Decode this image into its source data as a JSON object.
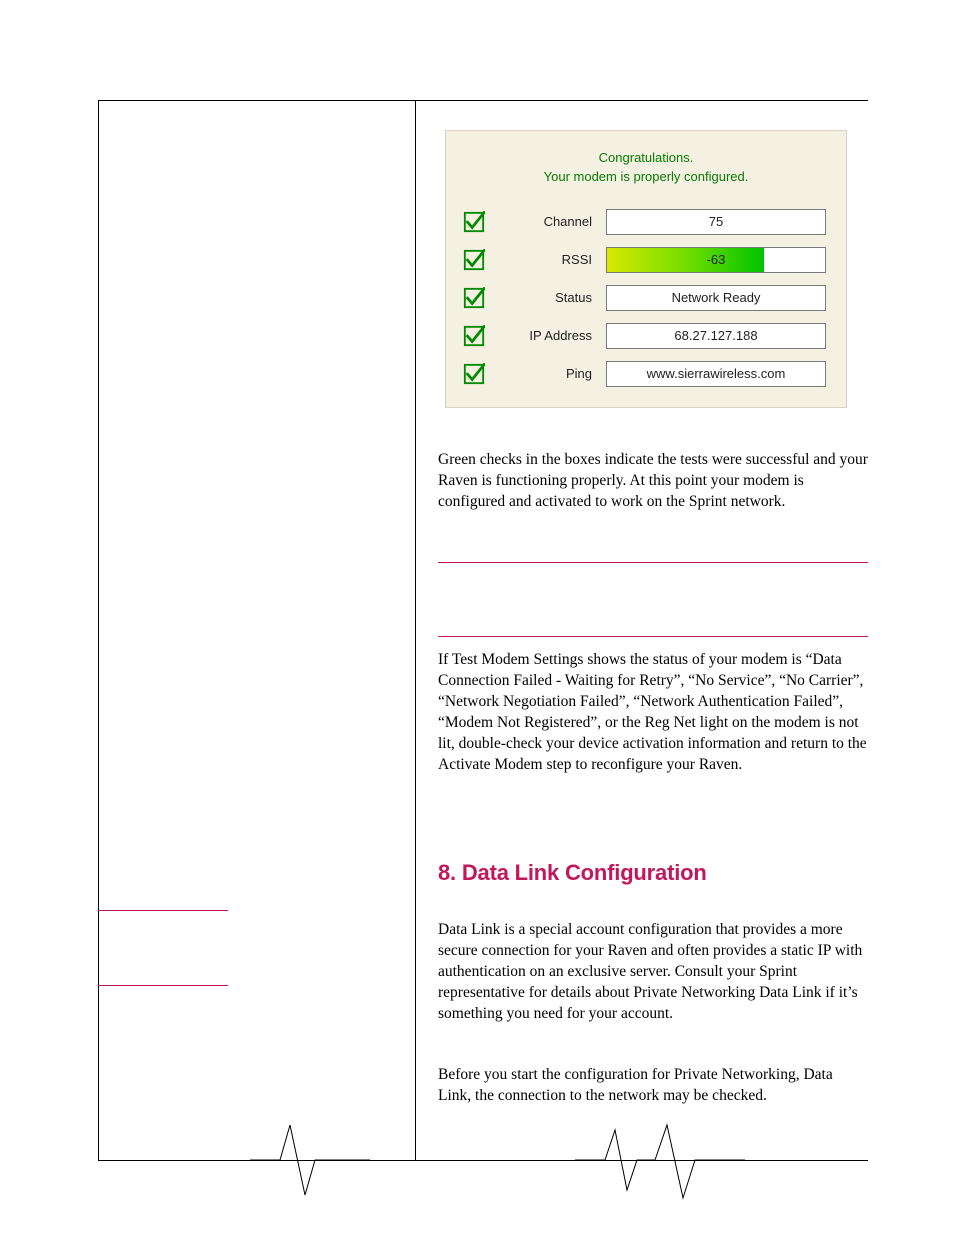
{
  "panel": {
    "congrats_line1": "Congratulations.",
    "congrats_line2": "Your modem is properly configured.",
    "rows": [
      {
        "label": "Channel",
        "value": "75"
      },
      {
        "label": "RSSI",
        "value": "-63"
      },
      {
        "label": "Status",
        "value": "Network Ready"
      },
      {
        "label": "IP Address",
        "value": "68.27.127.188"
      },
      {
        "label": "Ping",
        "value": "www.sierrawireless.com"
      }
    ]
  },
  "body": {
    "para1": "Green checks in the boxes indicate the tests were successful and your Raven is functioning properly. At this point your modem is configured and activated to work on the Sprint network.",
    "para2": "If Test Modem Settings shows the status of your modem is “Data Connection Failed - Waiting for Retry”, “No Service”, “No Carrier”, “Network Negotiation Failed”, “Network Authentication Failed”, “Modem Not Registered”, or the Reg Net light on the modem is not lit, double-check your device activation information and return to the Activate Modem step to reconfigure your Raven.",
    "heading": "8. Data Link Configuration",
    "para3": " Data Link is a special account configuration that provides a more secure connection for your Raven and often provides a static IP with authentication on an exclusive server. Consult your Sprint representative for details about Private Networking Data Link if it’s something you need for your account.",
    "para4": "Before you start the configuration for Private Networking, Data Link, the connection to the network may be checked."
  }
}
